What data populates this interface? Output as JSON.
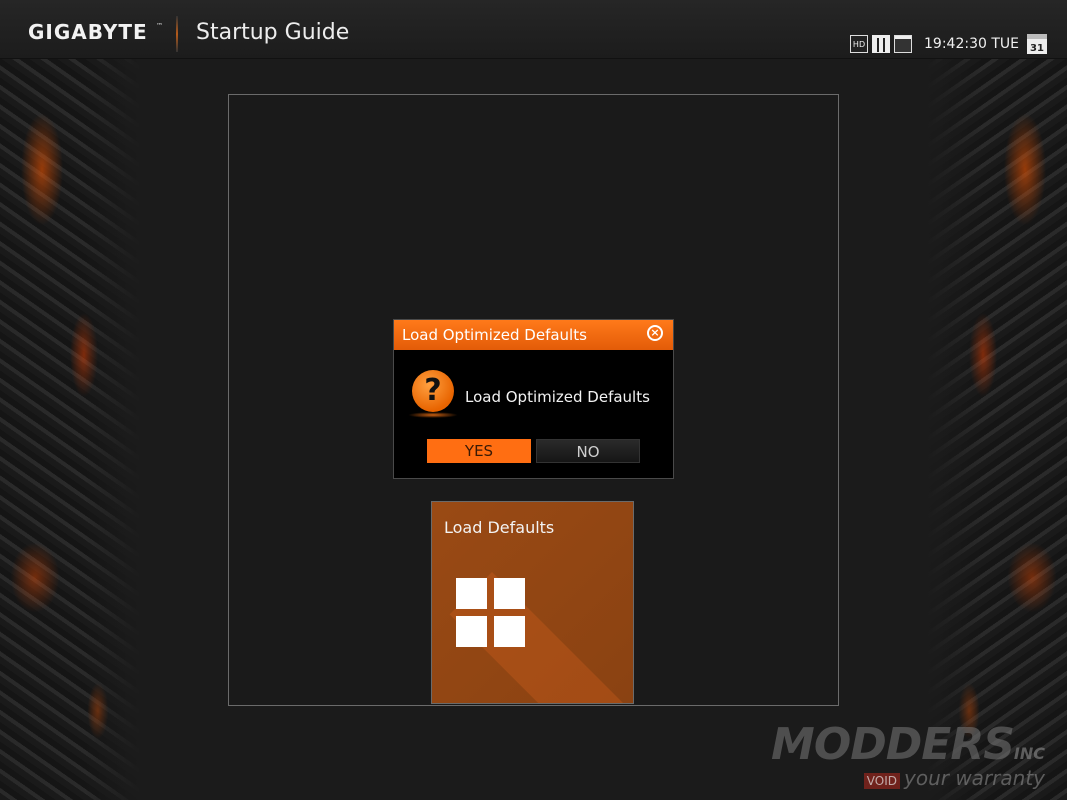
{
  "header": {
    "brand": "GIGABYTE",
    "brand_tm": "™",
    "title": "Startup Guide",
    "tray_icons": [
      "hd-icon",
      "grid-view-icon",
      "window-view-icon"
    ],
    "tray_hd_label": "HD",
    "clock": "19:42:30 TUE",
    "calendar_day": "31"
  },
  "dialog": {
    "title": "Load Optimized Defaults",
    "message": "Load Optimized Defaults",
    "question_mark": "?",
    "close_glyph": "×",
    "yes_label": "YES",
    "no_label": "NO",
    "accent_color": "#ff6e12"
  },
  "tile": {
    "label": "Load Defaults",
    "color": "#9a4a14",
    "icon": "windows-logo-icon"
  },
  "watermark": {
    "main": "MODDERS",
    "inc": "INC",
    "void": "VOID",
    "tagline": "your warranty"
  }
}
